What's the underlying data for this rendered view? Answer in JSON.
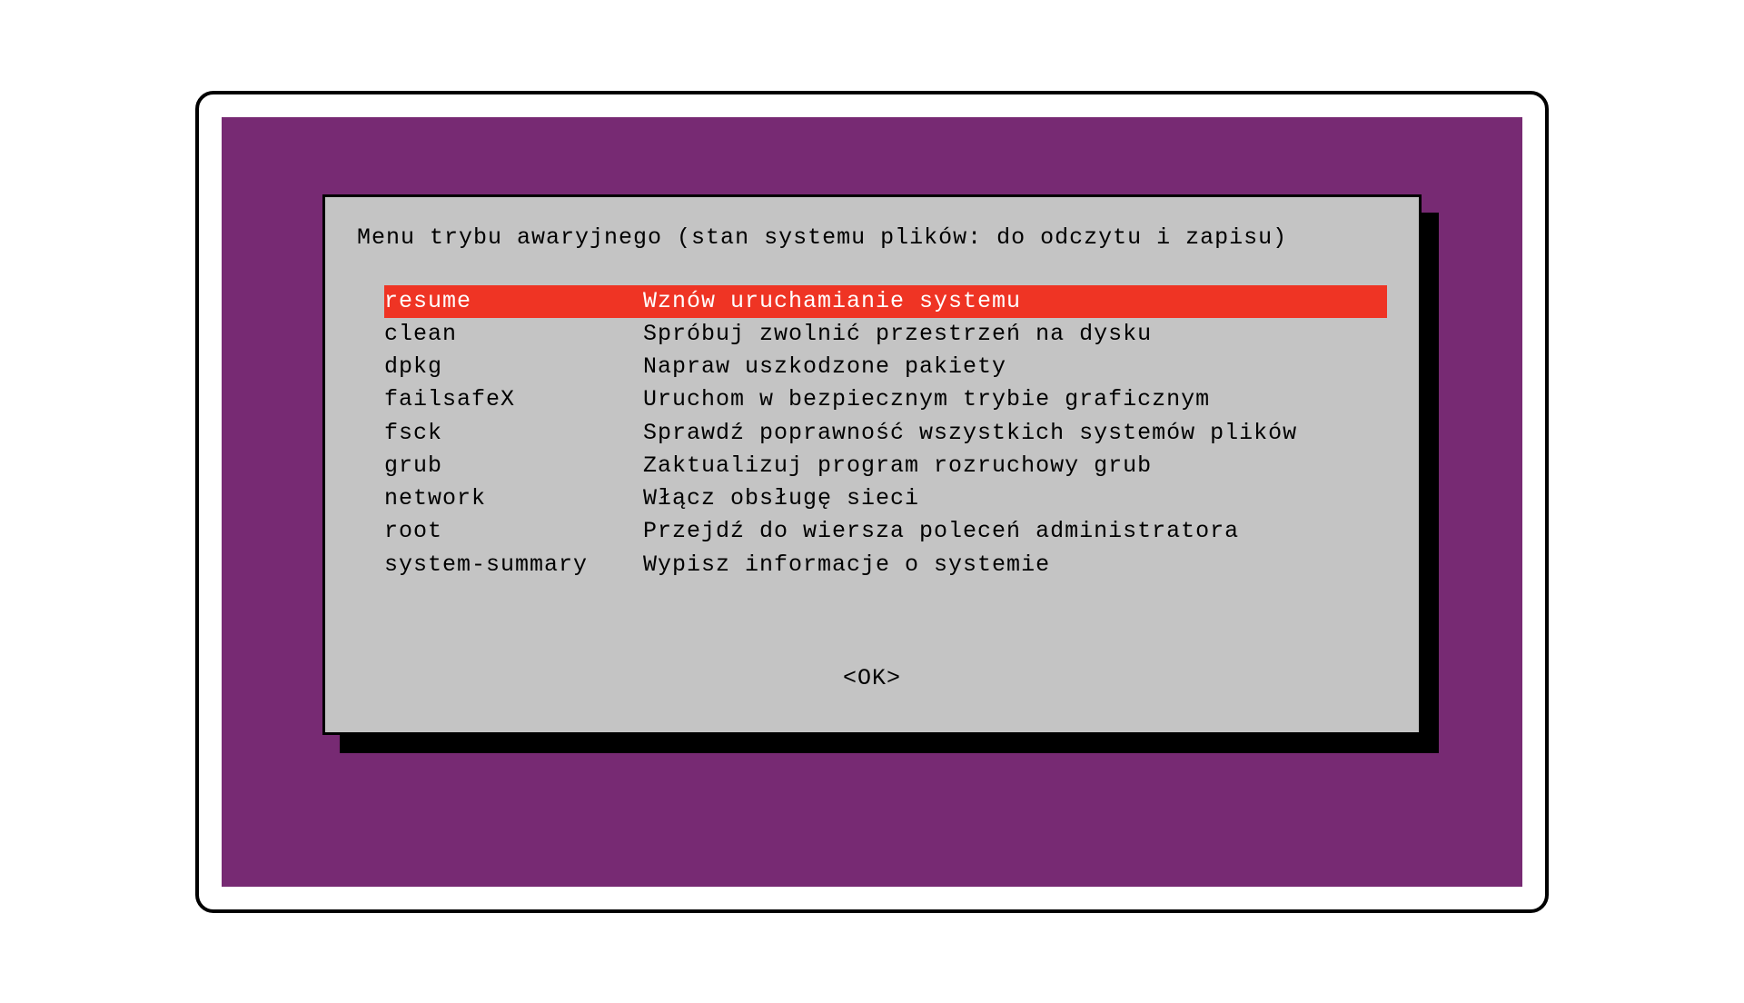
{
  "dialog": {
    "title": "Menu trybu awaryjnego (stan systemu plików: do odczytu i zapisu)",
    "ok_label": "<OK>"
  },
  "menu": {
    "items": [
      {
        "name": "resume",
        "description": "Wznów uruchamianie systemu",
        "selected": true
      },
      {
        "name": "clean",
        "description": "Spróbuj zwolnić przestrzeń na dysku",
        "selected": false
      },
      {
        "name": "dpkg",
        "description": "Napraw uszkodzone pakiety",
        "selected": false
      },
      {
        "name": "failsafeX",
        "description": "Uruchom w bezpiecznym trybie graficznym",
        "selected": false
      },
      {
        "name": "fsck",
        "description": "Sprawdź poprawność wszystkich systemów plików",
        "selected": false
      },
      {
        "name": "grub",
        "description": "Zaktualizuj program rozruchowy grub",
        "selected": false
      },
      {
        "name": "network",
        "description": "Włącz obsługę sieci",
        "selected": false
      },
      {
        "name": "root",
        "description": "Przejdź do wiersza poleceń administratora",
        "selected": false
      },
      {
        "name": "system-summary",
        "description": "Wypisz informacje o systemie",
        "selected": false
      }
    ]
  }
}
